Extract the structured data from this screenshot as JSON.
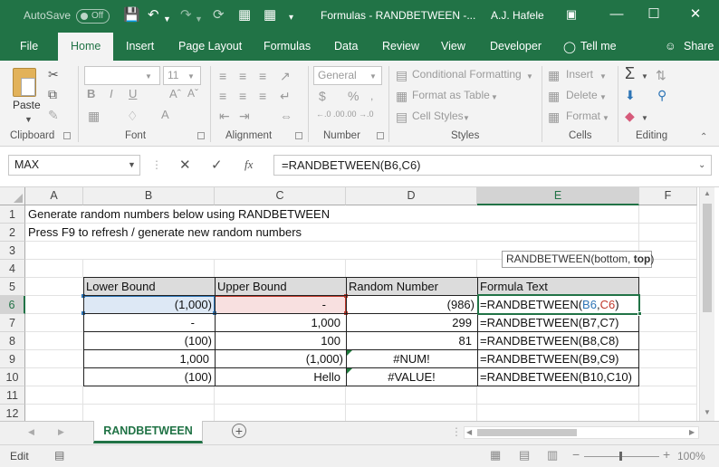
{
  "title_bar": {
    "autosave_label": "AutoSave",
    "autosave_state": "Off",
    "document_title": "Formulas - RANDBETWEEN  -...",
    "user": "A.J. Hafele"
  },
  "tabs": [
    "File",
    "Home",
    "Insert",
    "Page Layout",
    "Formulas",
    "Data",
    "Review",
    "View",
    "Developer",
    "Tell me",
    "Share"
  ],
  "ribbon": {
    "clipboard": {
      "paste": "Paste",
      "label": "Clipboard"
    },
    "font": {
      "name": "",
      "size": "11",
      "label": "Font"
    },
    "alignment": {
      "label": "Alignment"
    },
    "number": {
      "format": "General",
      "label": "Number",
      "inc_dec_1": "←.0 .00",
      "inc_dec_2": ".00 →.0"
    },
    "styles": {
      "cond": "Conditional Formatting",
      "table": "Format as Table",
      "cell": "Cell Styles",
      "label": "Styles"
    },
    "cells": {
      "insert": "Insert",
      "delete": "Delete",
      "format": "Format",
      "label": "Cells"
    },
    "editing": {
      "label": "Editing"
    }
  },
  "formula_bar": {
    "name_box": "MAX",
    "formula": "=RANDBETWEEN(B6,C6)"
  },
  "columns": [
    "A",
    "B",
    "C",
    "D",
    "E",
    "F"
  ],
  "rows": [
    "1",
    "2",
    "3",
    "4",
    "5",
    "6",
    "7",
    "8",
    "9",
    "10",
    "11",
    "12"
  ],
  "cells": {
    "A1": "Generate random numbers below using RANDBETWEEN",
    "A2": "Press F9 to refresh / generate new random numbers",
    "B5": "Lower Bound",
    "C5": "Upper Bound",
    "D5": "Random Number",
    "E5": "Formula Text",
    "B6": "(1,000)",
    "C6": "-",
    "D6": "(986)",
    "E6_pre": "=RANDBETWEEN(",
    "E6_b": "B6",
    "E6_comma": ",",
    "E6_c": "C6",
    "E6_post": ")",
    "B7": "-",
    "C7": "1,000",
    "D7": "299",
    "E7": "=RANDBETWEEN(B7,C7)",
    "B8": "(100)",
    "C8": "100",
    "D8": "81",
    "E8": "=RANDBETWEEN(B8,C8)",
    "B9": "1,000",
    "C9": "(1,000)",
    "D9": "#NUM!",
    "E9": "=RANDBETWEEN(B9,C9)",
    "B10": "(100)",
    "C10": "Hello",
    "D10": "#VALUE!",
    "E10": "=RANDBETWEEN(B10,C10)"
  },
  "tooltip": {
    "pre": "RANDBETWEEN(bottom, ",
    "bold": "top",
    "post": ")"
  },
  "sheet_tab": "RANDBETWEEN",
  "status": {
    "mode": "Edit",
    "zoom": "100%"
  },
  "colors": {
    "accent": "#217346",
    "ref_blue": "#2e75b6",
    "ref_red": "#c0392b"
  }
}
